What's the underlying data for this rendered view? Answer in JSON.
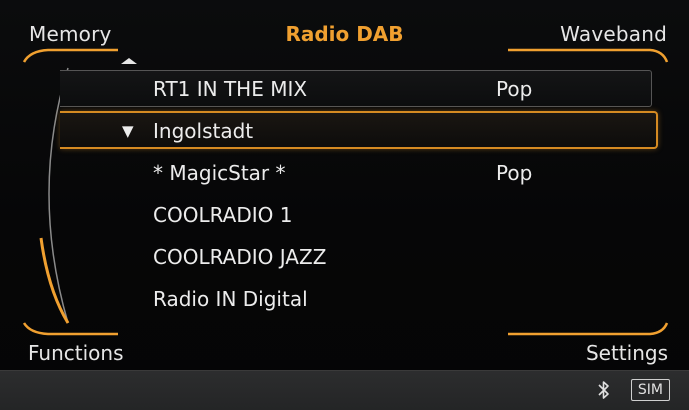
{
  "header": {
    "left_label": "Memory",
    "title": "Radio DAB",
    "right_label": "Waveband"
  },
  "stations": [
    {
      "name": "RT1 IN THE MIX",
      "genre": "Pop",
      "state": "playing"
    },
    {
      "name": "Ingolstadt",
      "genre": "",
      "state": "selected",
      "expand_icon": "triangle-down-icon"
    },
    {
      "name": "* MagicStar *",
      "genre": "Pop",
      "state": "normal"
    },
    {
      "name": "COOLRADIO 1",
      "genre": "",
      "state": "normal"
    },
    {
      "name": "COOLRADIO JAZZ",
      "genre": "",
      "state": "normal"
    },
    {
      "name": "Radio IN Digital",
      "genre": "",
      "state": "normal"
    }
  ],
  "footer": {
    "left_label": "Functions",
    "right_label": "Settings"
  },
  "status": {
    "bluetooth_icon": "bluetooth-icon",
    "sim_label": "SIM"
  },
  "colors": {
    "accent": "#f0a030",
    "text": "#e9e9e9",
    "background": "#060607",
    "statusbar": "#262728"
  }
}
